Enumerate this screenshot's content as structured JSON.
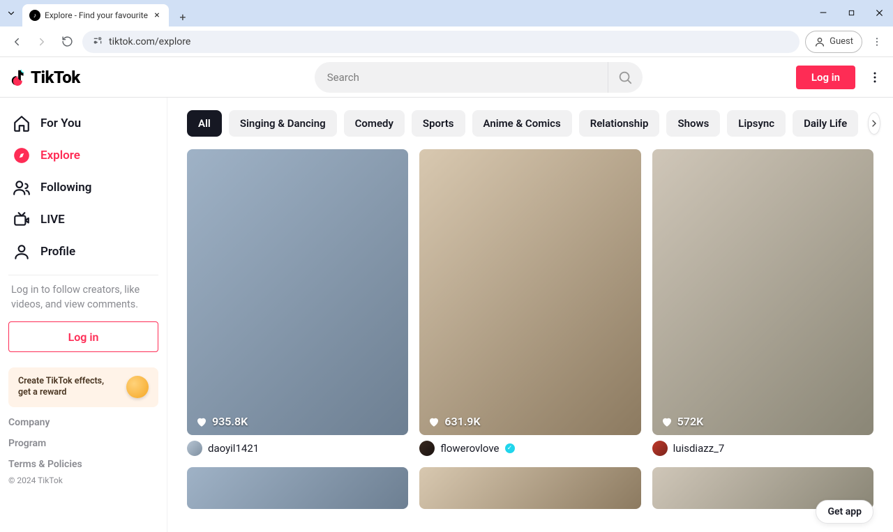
{
  "browser": {
    "tab_title": "Explore - Find your favourite",
    "url": "tiktok.com/explore",
    "guest_label": "Guest"
  },
  "header": {
    "logo_text": "TikTok",
    "search_placeholder": "Search",
    "login_label": "Log in"
  },
  "sidebar": {
    "items": [
      {
        "label": "For You"
      },
      {
        "label": "Explore"
      },
      {
        "label": "Following"
      },
      {
        "label": "LIVE"
      },
      {
        "label": "Profile"
      }
    ],
    "hint_text": "Log in to follow creators, like videos, and view comments.",
    "login_label": "Log in",
    "effects_text": "Create TikTok effects, get a reward",
    "footer_links": [
      "Company",
      "Program",
      "Terms & Policies"
    ],
    "copyright": "© 2024 TikTok"
  },
  "categories": [
    "All",
    "Singing & Dancing",
    "Comedy",
    "Sports",
    "Anime & Comics",
    "Relationship",
    "Shows",
    "Lipsync",
    "Daily Life"
  ],
  "videos": [
    {
      "likes": "935.8K",
      "author": "daoyil1421",
      "verified": false
    },
    {
      "likes": "631.9K",
      "author": "flowerovlove",
      "verified": true
    },
    {
      "likes": "572K",
      "author": "luisdiazz_7",
      "verified": false
    }
  ],
  "get_app_label": "Get app"
}
